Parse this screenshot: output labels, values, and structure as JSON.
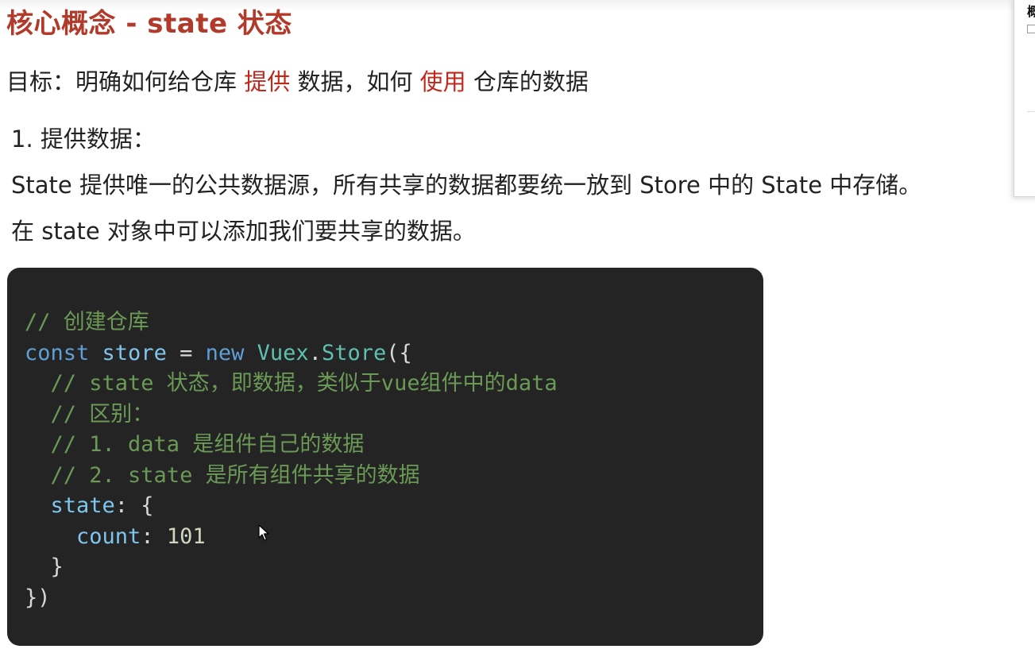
{
  "title": "核心概念 - state 状态",
  "goal": {
    "prefix": "目标：明确如何给仓库 ",
    "highlight1": "提供",
    "middle": " 数据，如何 ",
    "highlight2": "使用",
    "suffix": " 仓库的数据"
  },
  "step1_heading": "1. 提供数据：",
  "paragraph1": "State 提供唯一的公共数据源，所有共享的数据都要统一放到 Store 中的 State 中存储。",
  "paragraph2": "在 state 对象中可以添加我们要共享的数据。",
  "code": {
    "line1": "// 创建仓库",
    "line2": {
      "kw": "const",
      "sp1": " ",
      "var": "store",
      "op": " = ",
      "kw2": "new",
      "sp2": " ",
      "cls1": "Vuex",
      "dot": ".",
      "cls2": "Store",
      "rest": "({"
    },
    "line3": "  // state 状态，即数据，类似于vue组件中的data",
    "line4": "  // 区别：",
    "line5": "  // 1. data 是组件自己的数据",
    "line6": "  // 2. state 是所有组件共享的数据",
    "line7": {
      "indent": "  ",
      "key": "state",
      "rest": ": {"
    },
    "line8": {
      "indent": "    ",
      "key": "count",
      "colon": ": ",
      "value": "101"
    },
    "line9": "  }",
    "line10": "})"
  },
  "colors": {
    "title": "#b23a2b",
    "highlight": "#c0281c",
    "code_bg": "#242424",
    "comment": "#6a9a55",
    "keyword": "#5f9fd6"
  },
  "icons": {
    "cursor": "mouse-pointer-icon",
    "checkbox": "checkbox-icon"
  },
  "side_panel": {
    "title": "概"
  }
}
